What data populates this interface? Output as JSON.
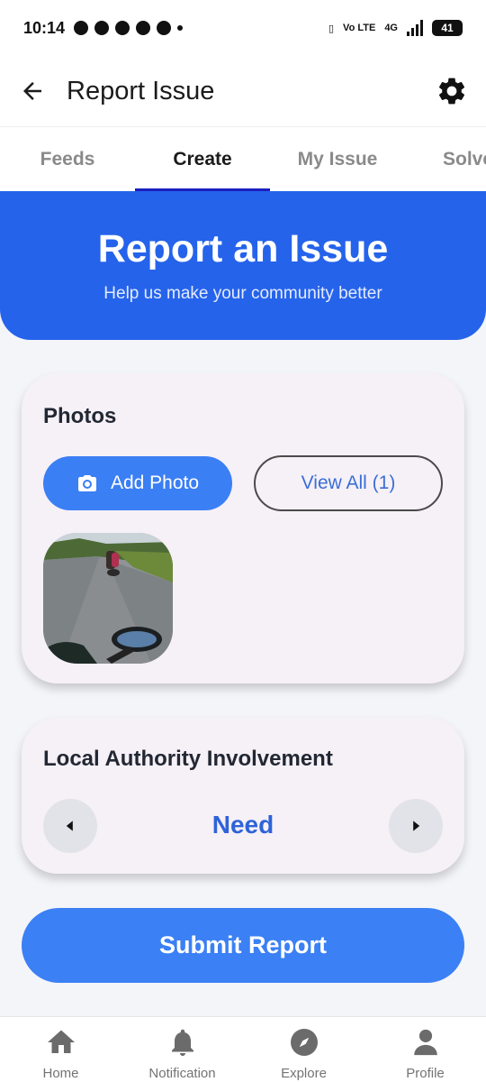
{
  "status_bar": {
    "time": "10:14",
    "battery": "41",
    "network": "4G",
    "volte": "Vo LTE"
  },
  "app_bar": {
    "title": "Report Issue"
  },
  "tabs": [
    {
      "label": "Feeds"
    },
    {
      "label": "Create"
    },
    {
      "label": "My Issue"
    },
    {
      "label": "Solve"
    }
  ],
  "active_tab": "Create",
  "hero": {
    "title": "Report an Issue",
    "subtitle": "Help us make your community better"
  },
  "photos": {
    "title": "Photos",
    "add_label": "Add Photo",
    "view_all_label": "View All (1)"
  },
  "authority": {
    "title": "Local Authority Involvement",
    "value": "Need"
  },
  "submit": {
    "label": "Submit Report"
  },
  "nav": [
    {
      "label": "Home",
      "icon": "home-icon"
    },
    {
      "label": "Notification",
      "icon": "bell-icon"
    },
    {
      "label": "Explore",
      "icon": "compass-icon"
    },
    {
      "label": "Profile",
      "icon": "person-icon"
    }
  ],
  "colors": {
    "primary": "#2563eb",
    "button": "#3b80f4",
    "card": "#f6f0f7",
    "accent_text": "#2e63d8"
  }
}
